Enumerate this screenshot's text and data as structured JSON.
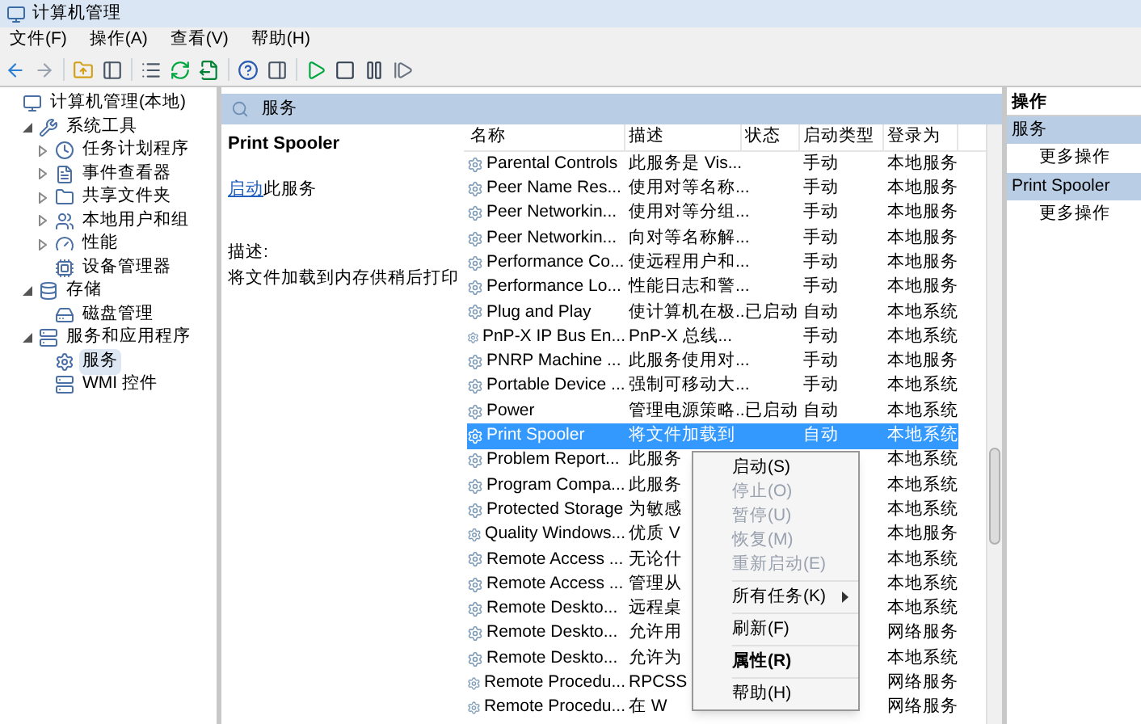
{
  "window": {
    "title": "计算机管理"
  },
  "menu": [
    "文件(F)",
    "操作(A)",
    "查看(V)",
    "帮助(H)"
  ],
  "tree": [
    {
      "label": "计算机管理(本地)",
      "kind": "root",
      "selected": false,
      "children": [
        {
          "label": "系统工具",
          "kind": "node",
          "expanded": true,
          "selected": false,
          "children": [
            {
              "label": "任务计划程序",
              "kind": "node",
              "expanded": false,
              "selected": false
            },
            {
              "label": "事件查看器",
              "kind": "node",
              "expanded": false,
              "selected": false
            },
            {
              "label": "共享文件夹",
              "kind": "node",
              "expanded": false,
              "selected": false
            },
            {
              "label": "本地用户和组",
              "kind": "node",
              "expanded": false,
              "selected": false
            },
            {
              "label": "性能",
              "kind": "node",
              "expanded": false,
              "selected": false
            },
            {
              "label": "设备管理器",
              "kind": "leaf",
              "selected": false
            }
          ]
        },
        {
          "label": "存储",
          "kind": "node",
          "expanded": true,
          "selected": false,
          "children": [
            {
              "label": "磁盘管理",
              "kind": "leaf",
              "selected": false
            }
          ]
        },
        {
          "label": "服务和应用程序",
          "kind": "node",
          "expanded": true,
          "selected": false,
          "children": [
            {
              "label": "服务",
              "kind": "leaf",
              "selected": true
            },
            {
              "label": "WMI 控件",
              "kind": "leaf",
              "selected": false
            }
          ]
        }
      ]
    }
  ],
  "services_header": "服务",
  "detail": {
    "name": "Print Spooler",
    "link": "启动",
    "link_rest": "此服务",
    "desc_label": "描述:",
    "desc": "将文件加载到内存供稍后打印"
  },
  "table": {
    "columns": [
      "名称",
      "描述",
      "状态",
      "启动类型",
      "登录为"
    ],
    "rows": [
      {
        "name": "Parental Controls",
        "desc": "此服务是 Vis...",
        "status": "",
        "start": "手动",
        "logon": "本地服务",
        "selected": false
      },
      {
        "name": "Peer Name Res...",
        "desc": "使用对等名称...",
        "status": "",
        "start": "手动",
        "logon": "本地服务",
        "selected": false
      },
      {
        "name": "Peer Networkin...",
        "desc": "使用对等分组...",
        "status": "",
        "start": "手动",
        "logon": "本地服务",
        "selected": false
      },
      {
        "name": "Peer Networkin...",
        "desc": "向对等名称解...",
        "status": "",
        "start": "手动",
        "logon": "本地服务",
        "selected": false
      },
      {
        "name": "Performance Co...",
        "desc": "使远程用户和...",
        "status": "",
        "start": "手动",
        "logon": "本地服务",
        "selected": false
      },
      {
        "name": "Performance Lo...",
        "desc": "性能日志和警...",
        "status": "",
        "start": "手动",
        "logon": "本地服务",
        "selected": false
      },
      {
        "name": "Plug and Play",
        "desc": "使计算机在极...",
        "status": "已启动",
        "start": "自动",
        "logon": "本地系统",
        "selected": false
      },
      {
        "name": "PnP-X IP Bus En...",
        "desc": "PnP-X 总线...",
        "status": "",
        "start": "手动",
        "logon": "本地系统",
        "selected": false
      },
      {
        "name": "PNRP Machine ...",
        "desc": "此服务使用对...",
        "status": "",
        "start": "手动",
        "logon": "本地服务",
        "selected": false
      },
      {
        "name": "Portable Device ...",
        "desc": "强制可移动大...",
        "status": "",
        "start": "手动",
        "logon": "本地系统",
        "selected": false
      },
      {
        "name": "Power",
        "desc": "管理电源策略...",
        "status": "已启动",
        "start": "自动",
        "logon": "本地系统",
        "selected": false
      },
      {
        "name": "Print Spooler",
        "desc": "将文件加载到",
        "status": "",
        "start": "自动",
        "logon": "本地系统",
        "selected": true
      },
      {
        "name": "Problem Report...",
        "desc": "此服务",
        "status": "",
        "start": "",
        "logon": "本地系统",
        "selected": false
      },
      {
        "name": "Program Compa...",
        "desc": "此服务",
        "status": "",
        "start": "",
        "logon": "本地系统",
        "selected": false
      },
      {
        "name": "Protected Storage",
        "desc": "为敏感",
        "status": "",
        "start": "",
        "logon": "本地系统",
        "selected": false
      },
      {
        "name": "Quality Windows...",
        "desc": "优质 V",
        "status": "",
        "start": "",
        "logon": "本地服务",
        "selected": false
      },
      {
        "name": "Remote Access ...",
        "desc": "无论什",
        "status": "",
        "start": "",
        "logon": "本地系统",
        "selected": false
      },
      {
        "name": "Remote Access ...",
        "desc": "管理从",
        "status": "",
        "start": "",
        "logon": "本地系统",
        "selected": false
      },
      {
        "name": "Remote Deskto...",
        "desc": "远程桌",
        "status": "",
        "start": "",
        "logon": "本地系统",
        "selected": false
      },
      {
        "name": "Remote Deskto...",
        "desc": "允许用",
        "status": "",
        "start": "",
        "logon": "网络服务",
        "selected": false
      },
      {
        "name": "Remote Deskto...",
        "desc": "允许为",
        "status": "",
        "start": "",
        "logon": "本地系统",
        "selected": false
      },
      {
        "name": "Remote Procedu...",
        "desc": "RPCSS",
        "status": "",
        "start": "",
        "logon": "网络服务",
        "selected": false
      },
      {
        "name": "Remote Procedu...",
        "desc": "在 W",
        "status": "",
        "start": "",
        "logon": "网络服务",
        "selected": false
      }
    ]
  },
  "context_menu": [
    {
      "label": "启动(S)",
      "kind": "item",
      "disabled": false
    },
    {
      "label": "停止(O)",
      "kind": "item",
      "disabled": true
    },
    {
      "label": "暂停(U)",
      "kind": "item",
      "disabled": true
    },
    {
      "label": "恢复(M)",
      "kind": "item",
      "disabled": true
    },
    {
      "label": "重新启动(E)",
      "kind": "item",
      "disabled": true
    },
    {
      "kind": "separator"
    },
    {
      "label": "所有任务(K)",
      "kind": "submenu",
      "disabled": false
    },
    {
      "kind": "separator"
    },
    {
      "label": "刷新(F)",
      "kind": "item",
      "disabled": false
    },
    {
      "kind": "separator"
    },
    {
      "label": "属性(R)",
      "kind": "default",
      "disabled": false
    },
    {
      "kind": "separator"
    },
    {
      "label": "帮助(H)",
      "kind": "item",
      "disabled": false
    }
  ],
  "actions": {
    "title": "操作",
    "sections": [
      {
        "title": "服务",
        "items": [
          "更多操作"
        ]
      },
      {
        "title": "Print Spooler",
        "items": [
          "更多操作"
        ]
      }
    ]
  }
}
